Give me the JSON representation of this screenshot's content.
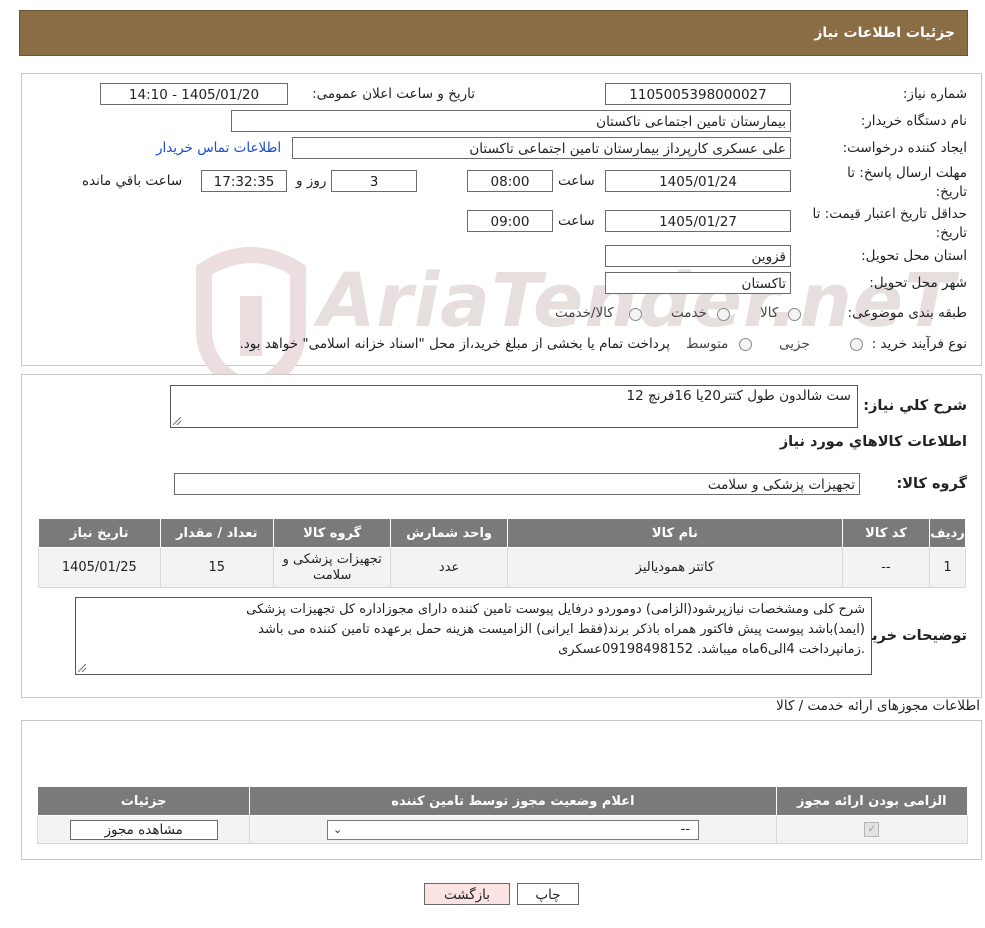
{
  "page_title": "جزئیات اطلاعات نیاز",
  "watermark": "AriaTender.neT",
  "fields": {
    "need_number_label": "شماره نیاز:",
    "need_number": "1105005398000027",
    "announce_label": "تاریخ و ساعت اعلان عمومی:",
    "announce_value": "1405/01/20 - 14:10",
    "buyer_org_label": "نام دستگاه خریدار:",
    "buyer_org": "بیمارستان تامین اجتماعی تاکستان",
    "creator_label": "ایجاد کننده درخواست:",
    "creator": "علی عسکری کارپرداز بیمارستان تامین اجتماعی تاکستان",
    "contact_link": "اطلاعات تماس خریدار",
    "deadline_label": "مهلت ارسال پاسخ: تا تاریخ:",
    "deadline_date": "1405/01/24",
    "time_word": "ساعت",
    "deadline_time": "08:00",
    "days_value": "3",
    "days_word": "روز و",
    "remaining_time": "17:32:35",
    "remaining_label": "ساعت باقي مانده",
    "validity_label": "حداقل تاریخ اعتبار قیمت: تا تاریخ:",
    "validity_date": "1405/01/27",
    "validity_time": "09:00",
    "province_label": "استان محل تحویل:",
    "province": "قزوین",
    "city_label": "شهر محل تحویل:",
    "city": "تاکستان",
    "category_label": "طبقه بندی موضوعی:",
    "category_options": [
      "کالا",
      "خدمت",
      "کالا/خدمت"
    ],
    "process_label": "نوع فرآیند خرید :",
    "process_options": [
      "جزیی",
      "متوسط"
    ],
    "process_note": "پرداخت تمام یا بخشی از مبلغ خرید،از محل \"اسناد خزانه اسلامی\" خواهد بود."
  },
  "summary": {
    "label": "شرح کلي نیاز:",
    "value": "ست شالدون طول کتتر20یا 16فرنچ 12",
    "goods_info_title": "اطلاعات کالاهاي مورد نیاز",
    "group_label": "گروه کالا:",
    "group_value": "تجهیزات پزشکی و سلامت"
  },
  "goods_table": {
    "headers": [
      "ردیف",
      "کد کالا",
      "نام کالا",
      "واحد شمارش",
      "گروه کالا",
      "تعداد / مقدار",
      "تاریخ نیاز"
    ],
    "rows": [
      [
        "1",
        "--",
        "کاتتر همودیالیز",
        "عدد",
        "تجهیزات پزشکی و سلامت",
        "15",
        "1405/01/25"
      ]
    ]
  },
  "buyer_notes": {
    "label": "توضیحات خریدار:",
    "lines": [
      "شرح کلی ومشخصات نیازپرشود(الزامی) دوموردو درفایل پیوست تامین کننده دارای مجوزاداره کل تجهیزات پزشکی",
      "(ایمد)باشد پیوست پیش فاکتور همراه باذکر برند(فقط ایرانی) الزامیست هزینه حمل برعهده تامین کننده می باشد",
      ".زمانپرداخت 4الی6ماه میباشد. 09198498152عسکری"
    ]
  },
  "permits": {
    "title": "اطلاعات مجوزهای ارائه خدمت / کالا",
    "headers": [
      "الزامی بودن ارائه مجوز",
      "اعلام وضعیت مجوز توسط تامین کننده",
      "جزئیات"
    ],
    "select_value": "--",
    "view_button": "مشاهده مجوز"
  },
  "buttons": {
    "print": "چاپ",
    "back": "بازگشت"
  },
  "colors": {
    "header_bg": "#8a6d44",
    "table_header_bg": "#7a7a7a",
    "back_button_bg": "#fbe3e3",
    "link": "#1a4ecf"
  }
}
